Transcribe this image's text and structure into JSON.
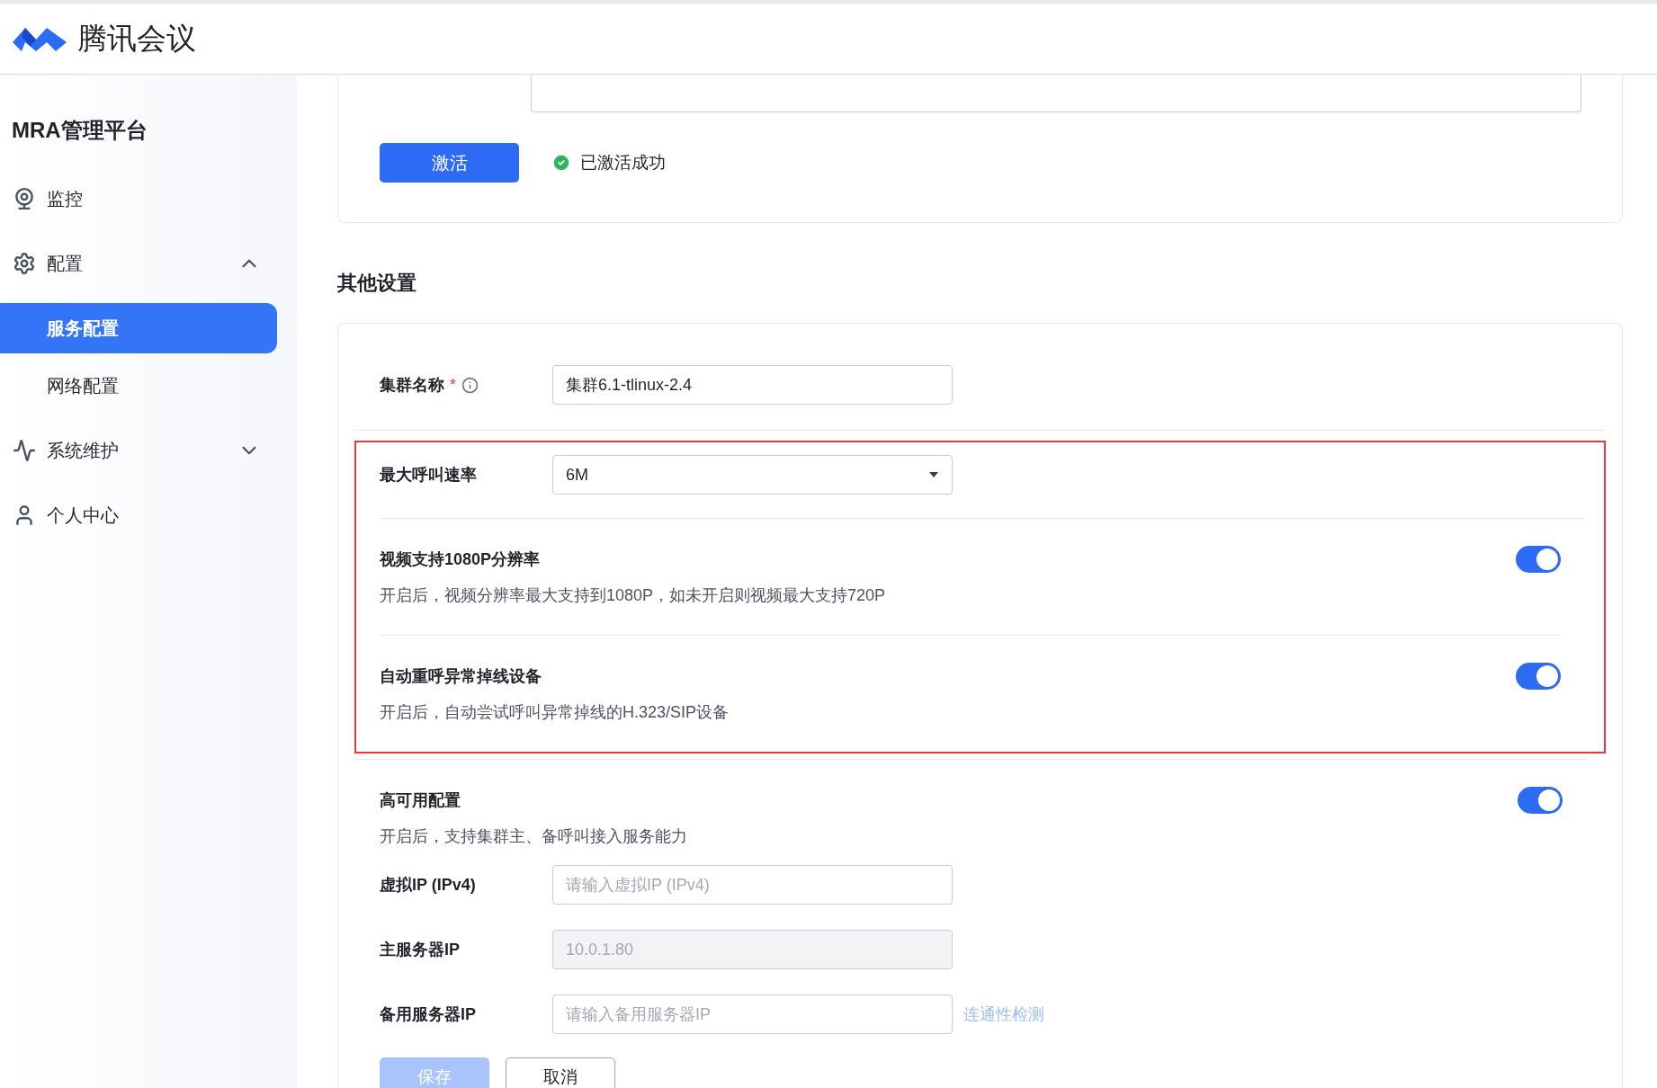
{
  "header": {
    "brand": "腾讯会议"
  },
  "sidebar": {
    "title": "MRA管理平台",
    "items": [
      {
        "label": "监控",
        "selected": false
      },
      {
        "label": "配置",
        "selected": false,
        "expanded": true,
        "children": [
          {
            "label": "服务配置",
            "selected": true
          },
          {
            "label": "网络配置",
            "selected": false
          }
        ]
      },
      {
        "label": "系统维护",
        "selected": false,
        "expanded": false
      },
      {
        "label": "个人中心",
        "selected": false
      }
    ]
  },
  "activation": {
    "button": "激活",
    "status": "已激活成功"
  },
  "other_settings": {
    "title": "其他设置",
    "cluster_name": {
      "label": "集群名称",
      "required_mark": "*",
      "value": "集群6.1-tlinux-2.4"
    },
    "highlighted_group": {
      "max_call_rate": {
        "label": "最大呼叫速率",
        "value": "6M"
      },
      "toggles": [
        {
          "title": "视频支持1080P分辨率",
          "description": "开启后，视频分辨率最大支持到1080P，如未开启则视频最大支持720P",
          "on": true
        },
        {
          "title": "自动重呼异常掉线设备",
          "description": "开启后，自动尝试呼叫异常掉线的H.323/SIP设备",
          "on": true
        }
      ]
    },
    "high_availability": {
      "title": "高可用配置",
      "description": "开启后，支持集群主、备呼叫接入服务能力",
      "on": true,
      "fields": [
        {
          "label": "虚拟IP (IPv4)",
          "placeholder": "请输入虚拟IP (IPv4)",
          "disabled": false
        },
        {
          "label": "主服务器IP",
          "value": "10.0.1.80",
          "disabled": true
        },
        {
          "label": "备用服务器IP",
          "placeholder": "请输入备用服务器IP",
          "disabled": false,
          "link": "连通性检测"
        }
      ]
    },
    "save": {
      "label": "保存",
      "disabled": true
    },
    "cancel": {
      "label": "取消"
    }
  }
}
